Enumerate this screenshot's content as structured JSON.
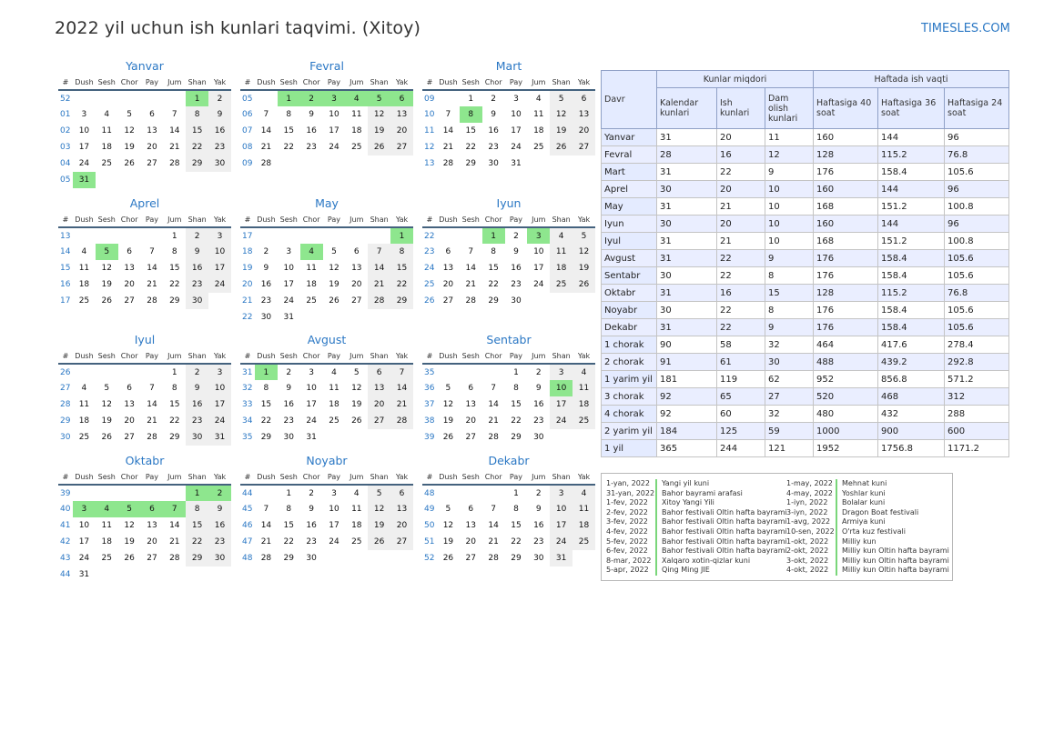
{
  "title": "2022 yil uchun ish kunlari taqvimi. (Xitoy)",
  "site": "TIMESLES.COM",
  "colors": {
    "accent": "#2a77c4",
    "holiday": "#8ee68e",
    "weekend": "#efefef"
  },
  "day_headers": [
    "#",
    "Dush",
    "Sesh",
    "Chor",
    "Pay",
    "Jum",
    "Shan",
    "Yak"
  ],
  "months": [
    {
      "name": "Yanvar",
      "rows": [
        [
          "52",
          "",
          "",
          "",
          "",
          "",
          "1",
          "2"
        ],
        [
          "01",
          "3",
          "4",
          "5",
          "6",
          "7",
          "8",
          "9"
        ],
        [
          "02",
          "10",
          "11",
          "12",
          "13",
          "14",
          "15",
          "16"
        ],
        [
          "03",
          "17",
          "18",
          "19",
          "20",
          "21",
          "22",
          "23"
        ],
        [
          "04",
          "24",
          "25",
          "26",
          "27",
          "28",
          "29",
          "30"
        ],
        [
          "05",
          "31",
          "",
          "",
          "",
          "",
          "",
          ""
        ]
      ],
      "holidays": [
        "1",
        "31"
      ]
    },
    {
      "name": "Fevral",
      "rows": [
        [
          "05",
          "",
          "1",
          "2",
          "3",
          "4",
          "5",
          "6"
        ],
        [
          "06",
          "7",
          "8",
          "9",
          "10",
          "11",
          "12",
          "13"
        ],
        [
          "07",
          "14",
          "15",
          "16",
          "17",
          "18",
          "19",
          "20"
        ],
        [
          "08",
          "21",
          "22",
          "23",
          "24",
          "25",
          "26",
          "27"
        ],
        [
          "09",
          "28",
          "",
          "",
          "",
          "",
          "",
          ""
        ]
      ],
      "holidays": [
        "1",
        "2",
        "3",
        "4",
        "5",
        "6"
      ]
    },
    {
      "name": "Mart",
      "rows": [
        [
          "09",
          "",
          "1",
          "2",
          "3",
          "4",
          "5",
          "6"
        ],
        [
          "10",
          "7",
          "8",
          "9",
          "10",
          "11",
          "12",
          "13"
        ],
        [
          "11",
          "14",
          "15",
          "16",
          "17",
          "18",
          "19",
          "20"
        ],
        [
          "12",
          "21",
          "22",
          "23",
          "24",
          "25",
          "26",
          "27"
        ],
        [
          "13",
          "28",
          "29",
          "30",
          "31",
          "",
          "",
          ""
        ]
      ],
      "holidays": [
        "8"
      ]
    },
    {
      "name": "Aprel",
      "rows": [
        [
          "13",
          "",
          "",
          "",
          "",
          "1",
          "2",
          "3"
        ],
        [
          "14",
          "4",
          "5",
          "6",
          "7",
          "8",
          "9",
          "10"
        ],
        [
          "15",
          "11",
          "12",
          "13",
          "14",
          "15",
          "16",
          "17"
        ],
        [
          "16",
          "18",
          "19",
          "20",
          "21",
          "22",
          "23",
          "24"
        ],
        [
          "17",
          "25",
          "26",
          "27",
          "28",
          "29",
          "30",
          ""
        ]
      ],
      "holidays": [
        "5"
      ]
    },
    {
      "name": "May",
      "rows": [
        [
          "17",
          "",
          "",
          "",
          "",
          "",
          "",
          "1"
        ],
        [
          "18",
          "2",
          "3",
          "4",
          "5",
          "6",
          "7",
          "8"
        ],
        [
          "19",
          "9",
          "10",
          "11",
          "12",
          "13",
          "14",
          "15"
        ],
        [
          "20",
          "16",
          "17",
          "18",
          "19",
          "20",
          "21",
          "22"
        ],
        [
          "21",
          "23",
          "24",
          "25",
          "26",
          "27",
          "28",
          "29"
        ],
        [
          "22",
          "30",
          "31",
          "",
          "",
          "",
          "",
          ""
        ]
      ],
      "holidays": [
        "1",
        "4"
      ]
    },
    {
      "name": "Iyun",
      "rows": [
        [
          "22",
          "",
          "",
          "1",
          "2",
          "3",
          "4",
          "5"
        ],
        [
          "23",
          "6",
          "7",
          "8",
          "9",
          "10",
          "11",
          "12"
        ],
        [
          "24",
          "13",
          "14",
          "15",
          "16",
          "17",
          "18",
          "19"
        ],
        [
          "25",
          "20",
          "21",
          "22",
          "23",
          "24",
          "25",
          "26"
        ],
        [
          "26",
          "27",
          "28",
          "29",
          "30",
          "",
          "",
          ""
        ]
      ],
      "holidays": [
        "1",
        "3"
      ]
    },
    {
      "name": "Iyul",
      "rows": [
        [
          "26",
          "",
          "",
          "",
          "",
          "1",
          "2",
          "3"
        ],
        [
          "27",
          "4",
          "5",
          "6",
          "7",
          "8",
          "9",
          "10"
        ],
        [
          "28",
          "11",
          "12",
          "13",
          "14",
          "15",
          "16",
          "17"
        ],
        [
          "29",
          "18",
          "19",
          "20",
          "21",
          "22",
          "23",
          "24"
        ],
        [
          "30",
          "25",
          "26",
          "27",
          "28",
          "29",
          "30",
          "31"
        ]
      ],
      "holidays": []
    },
    {
      "name": "Avgust",
      "rows": [
        [
          "31",
          "1",
          "2",
          "3",
          "4",
          "5",
          "6",
          "7"
        ],
        [
          "32",
          "8",
          "9",
          "10",
          "11",
          "12",
          "13",
          "14"
        ],
        [
          "33",
          "15",
          "16",
          "17",
          "18",
          "19",
          "20",
          "21"
        ],
        [
          "34",
          "22",
          "23",
          "24",
          "25",
          "26",
          "27",
          "28"
        ],
        [
          "35",
          "29",
          "30",
          "31",
          "",
          "",
          "",
          ""
        ]
      ],
      "holidays": [
        "1"
      ]
    },
    {
      "name": "Sentabr",
      "rows": [
        [
          "35",
          "",
          "",
          "",
          "1",
          "2",
          "3",
          "4"
        ],
        [
          "36",
          "5",
          "6",
          "7",
          "8",
          "9",
          "10",
          "11"
        ],
        [
          "37",
          "12",
          "13",
          "14",
          "15",
          "16",
          "17",
          "18"
        ],
        [
          "38",
          "19",
          "20",
          "21",
          "22",
          "23",
          "24",
          "25"
        ],
        [
          "39",
          "26",
          "27",
          "28",
          "29",
          "30",
          "",
          ""
        ]
      ],
      "holidays": [
        "10"
      ]
    },
    {
      "name": "Oktabr",
      "rows": [
        [
          "39",
          "",
          "",
          "",
          "",
          "",
          "1",
          "2"
        ],
        [
          "40",
          "3",
          "4",
          "5",
          "6",
          "7",
          "8",
          "9"
        ],
        [
          "41",
          "10",
          "11",
          "12",
          "13",
          "14",
          "15",
          "16"
        ],
        [
          "42",
          "17",
          "18",
          "19",
          "20",
          "21",
          "22",
          "23"
        ],
        [
          "43",
          "24",
          "25",
          "26",
          "27",
          "28",
          "29",
          "30"
        ],
        [
          "44",
          "31",
          "",
          "",
          "",
          "",
          "",
          ""
        ]
      ],
      "holidays": [
        "1",
        "2",
        "3",
        "4",
        "5",
        "6",
        "7"
      ]
    },
    {
      "name": "Noyabr",
      "rows": [
        [
          "44",
          "",
          "1",
          "2",
          "3",
          "4",
          "5",
          "6"
        ],
        [
          "45",
          "7",
          "8",
          "9",
          "10",
          "11",
          "12",
          "13"
        ],
        [
          "46",
          "14",
          "15",
          "16",
          "17",
          "18",
          "19",
          "20"
        ],
        [
          "47",
          "21",
          "22",
          "23",
          "24",
          "25",
          "26",
          "27"
        ],
        [
          "48",
          "28",
          "29",
          "30",
          "",
          "",
          "",
          ""
        ]
      ],
      "holidays": []
    },
    {
      "name": "Dekabr",
      "rows": [
        [
          "48",
          "",
          "",
          "",
          "1",
          "2",
          "3",
          "4"
        ],
        [
          "49",
          "5",
          "6",
          "7",
          "8",
          "9",
          "10",
          "11"
        ],
        [
          "50",
          "12",
          "13",
          "14",
          "15",
          "16",
          "17",
          "18"
        ],
        [
          "51",
          "19",
          "20",
          "21",
          "22",
          "23",
          "24",
          "25"
        ],
        [
          "52",
          "26",
          "27",
          "28",
          "29",
          "30",
          "31",
          ""
        ]
      ],
      "holidays": []
    }
  ],
  "summary": {
    "davr": "Davr",
    "group1": "Kunlar miqdori",
    "group2": "Haftada ish vaqti",
    "cols": [
      "Kalendar kunlari",
      "Ish kunlari",
      "Dam olish kunlari",
      "Haftasiga 40 soat",
      "Haftasiga 36 soat",
      "Haftasiga 24 soat"
    ],
    "rows": [
      [
        "Yanvar",
        "31",
        "20",
        "11",
        "160",
        "144",
        "96"
      ],
      [
        "Fevral",
        "28",
        "16",
        "12",
        "128",
        "115.2",
        "76.8"
      ],
      [
        "Mart",
        "31",
        "22",
        "9",
        "176",
        "158.4",
        "105.6"
      ],
      [
        "Aprel",
        "30",
        "20",
        "10",
        "160",
        "144",
        "96"
      ],
      [
        "May",
        "31",
        "21",
        "10",
        "168",
        "151.2",
        "100.8"
      ],
      [
        "Iyun",
        "30",
        "20",
        "10",
        "160",
        "144",
        "96"
      ],
      [
        "Iyul",
        "31",
        "21",
        "10",
        "168",
        "151.2",
        "100.8"
      ],
      [
        "Avgust",
        "31",
        "22",
        "9",
        "176",
        "158.4",
        "105.6"
      ],
      [
        "Sentabr",
        "30",
        "22",
        "8",
        "176",
        "158.4",
        "105.6"
      ],
      [
        "Oktabr",
        "31",
        "16",
        "15",
        "128",
        "115.2",
        "76.8"
      ],
      [
        "Noyabr",
        "30",
        "22",
        "8",
        "176",
        "158.4",
        "105.6"
      ],
      [
        "Dekabr",
        "31",
        "22",
        "9",
        "176",
        "158.4",
        "105.6"
      ],
      [
        "1 chorak",
        "90",
        "58",
        "32",
        "464",
        "417.6",
        "278.4"
      ],
      [
        "2 chorak",
        "91",
        "61",
        "30",
        "488",
        "439.2",
        "292.8"
      ],
      [
        "1 yarim yil",
        "181",
        "119",
        "62",
        "952",
        "856.8",
        "571.2"
      ],
      [
        "3 chorak",
        "92",
        "65",
        "27",
        "520",
        "468",
        "312"
      ],
      [
        "4 chorak",
        "92",
        "60",
        "32",
        "480",
        "432",
        "288"
      ],
      [
        "2 yarim yil",
        "184",
        "125",
        "59",
        "1000",
        "900",
        "600"
      ],
      [
        "1 yil",
        "365",
        "244",
        "121",
        "1952",
        "1756.8",
        "1171.2"
      ]
    ]
  },
  "holidays_list": [
    [
      [
        "1-yan, 2022",
        "Yangi yil kuni"
      ],
      [
        "31-yan, 2022",
        "Bahor bayrami arafasi"
      ],
      [
        "1-fev, 2022",
        "Xitoy Yangi Yili"
      ],
      [
        "2-fev, 2022",
        "Bahor festivali Oltin hafta bayrami"
      ],
      [
        "3-fev, 2022",
        "Bahor festivali Oltin hafta bayrami"
      ],
      [
        "4-fev, 2022",
        "Bahor festivali Oltin hafta bayrami"
      ],
      [
        "5-fev, 2022",
        "Bahor festivali Oltin hafta bayrami"
      ],
      [
        "6-fev, 2022",
        "Bahor festivali Oltin hafta bayrami"
      ],
      [
        "8-mar, 2022",
        "Xalqaro xotin-qizlar kuni"
      ],
      [
        "5-apr, 2022",
        "Qing Ming JIE"
      ]
    ],
    [
      [
        "1-may, 2022",
        "Mehnat kuni"
      ],
      [
        "4-may, 2022",
        "Yoshlar kuni"
      ],
      [
        "1-iyn, 2022",
        "Bolalar kuni"
      ],
      [
        "3-iyn, 2022",
        "Dragon Boat festivali"
      ],
      [
        "1-avg, 2022",
        "Armiya kuni"
      ],
      [
        "10-sen, 2022",
        "O'rta kuz festivali"
      ],
      [
        "1-okt, 2022",
        "Milliy kun"
      ],
      [
        "2-okt, 2022",
        "Milliy kun Oltin hafta bayrami"
      ],
      [
        "3-okt, 2022",
        "Milliy kun Oltin hafta bayrami"
      ],
      [
        "4-okt, 2022",
        "Milliy kun Oltin hafta bayrami"
      ]
    ]
  ]
}
